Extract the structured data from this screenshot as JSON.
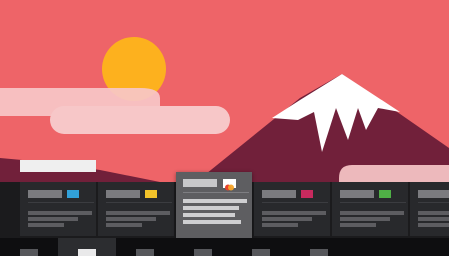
{
  "colors": {
    "sky": "#ee6468",
    "sun": "#fdb11e",
    "mountain": "#71203a",
    "snow": "#ffffff",
    "cloud": "#f7c7c8",
    "ribbon": "#1b1b1d",
    "card": "#28292c",
    "card_active": "#5e5e61",
    "tabbar": "#0e0e10"
  },
  "cards": [
    {
      "icon": "blue-square-icon",
      "icon_color": "#31a0d8"
    },
    {
      "icon": "yellow-square-icon",
      "icon_color": "#f2c22a"
    },
    {
      "icon": "dual-circle-card-icon",
      "icon_color": "#f7a52a"
    },
    {
      "icon": "magenta-square-icon",
      "icon_color": "#c72a5e"
    },
    {
      "icon": "green-square-icon",
      "icon_color": "#4fb046"
    },
    {
      "icon": "gray-square-icon",
      "icon_color": "#6b6b70"
    }
  ],
  "active_card": 2,
  "active_tab": 1,
  "tab_count": 6
}
